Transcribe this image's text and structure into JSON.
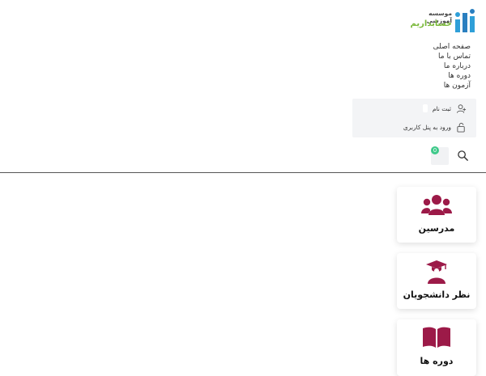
{
  "logo": {
    "line1": "موسسه آموزشی",
    "line2": "حسابداریم"
  },
  "nav": {
    "items": [
      {
        "label": "صفحه اصلی"
      },
      {
        "label": "تماس با ما"
      },
      {
        "label": "درباره ما"
      },
      {
        "label": "دوره ها"
      },
      {
        "label": "آزمون ها"
      }
    ]
  },
  "auth": {
    "register_label": "ثبت نام",
    "login_label": "ورود به پنل کاربری"
  },
  "cart": {
    "count": "0"
  },
  "cards": [
    {
      "title": "مدرسین",
      "icon": "users-icon"
    },
    {
      "title": "نظر دانشجویان",
      "icon": "graduate-icon"
    },
    {
      "title": "دوره ها",
      "icon": "book-icon"
    }
  ],
  "colors": {
    "accent": "#9c1a48",
    "brand_green": "#7ab83a",
    "badge": "#3ec98a"
  }
}
